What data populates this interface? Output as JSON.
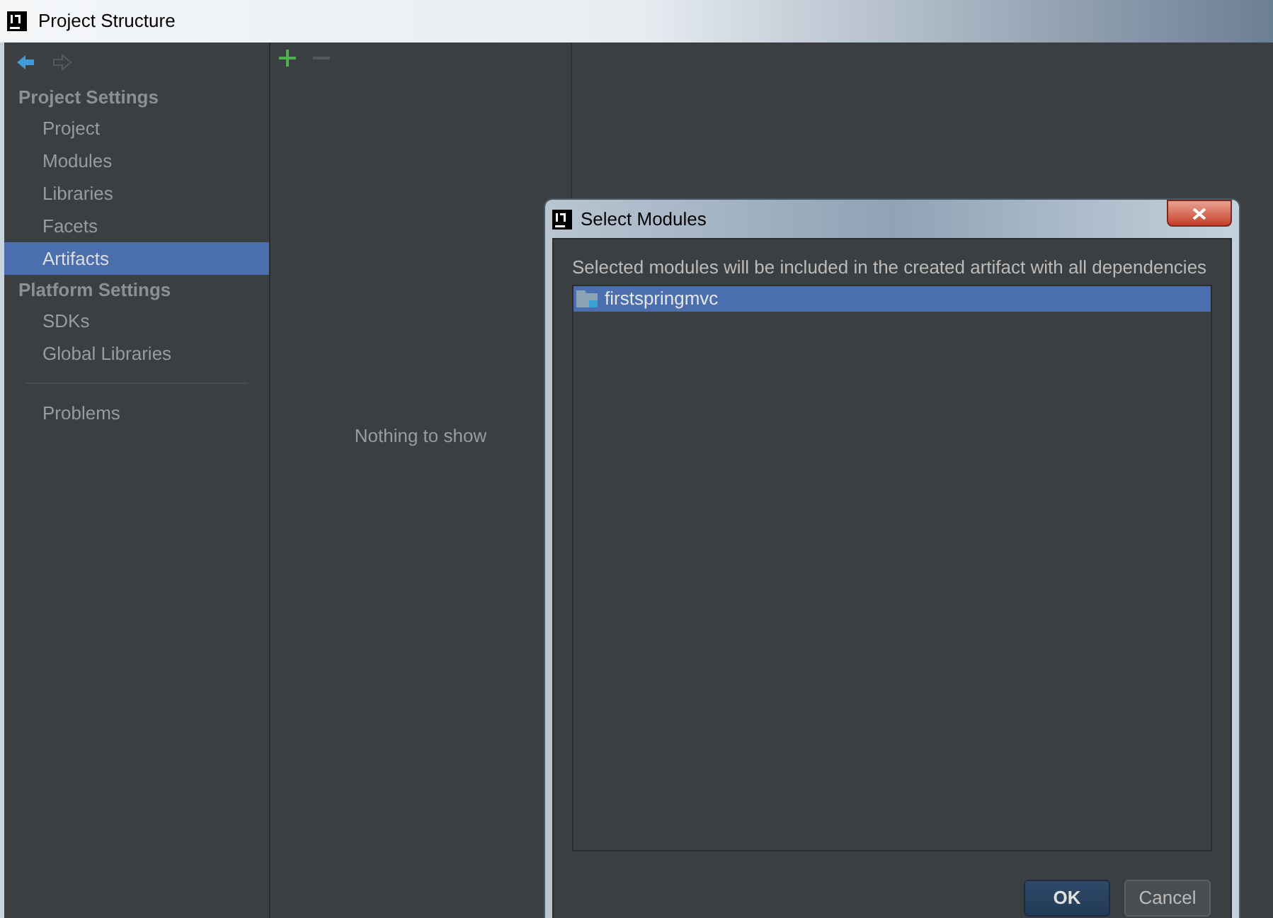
{
  "window": {
    "title": "Project Structure"
  },
  "sidebar": {
    "sections": [
      {
        "header": "Project Settings",
        "items": [
          {
            "label": "Project",
            "selected": false
          },
          {
            "label": "Modules",
            "selected": false
          },
          {
            "label": "Libraries",
            "selected": false
          },
          {
            "label": "Facets",
            "selected": false
          },
          {
            "label": "Artifacts",
            "selected": true
          }
        ]
      },
      {
        "header": "Platform Settings",
        "items": [
          {
            "label": "SDKs",
            "selected": false
          },
          {
            "label": "Global Libraries",
            "selected": false
          }
        ]
      }
    ],
    "extra_items": [
      {
        "label": "Problems",
        "selected": false
      }
    ]
  },
  "artifacts_panel": {
    "empty_text": "Nothing to show"
  },
  "dialog": {
    "title": "Select Modules",
    "message": "Selected modules will be included in the created artifact with all dependencies",
    "modules": [
      {
        "label": "firstspringmvc",
        "selected": true
      }
    ],
    "buttons": [
      {
        "label": "OK",
        "default": true
      },
      {
        "label": "Cancel",
        "default": false
      }
    ]
  }
}
